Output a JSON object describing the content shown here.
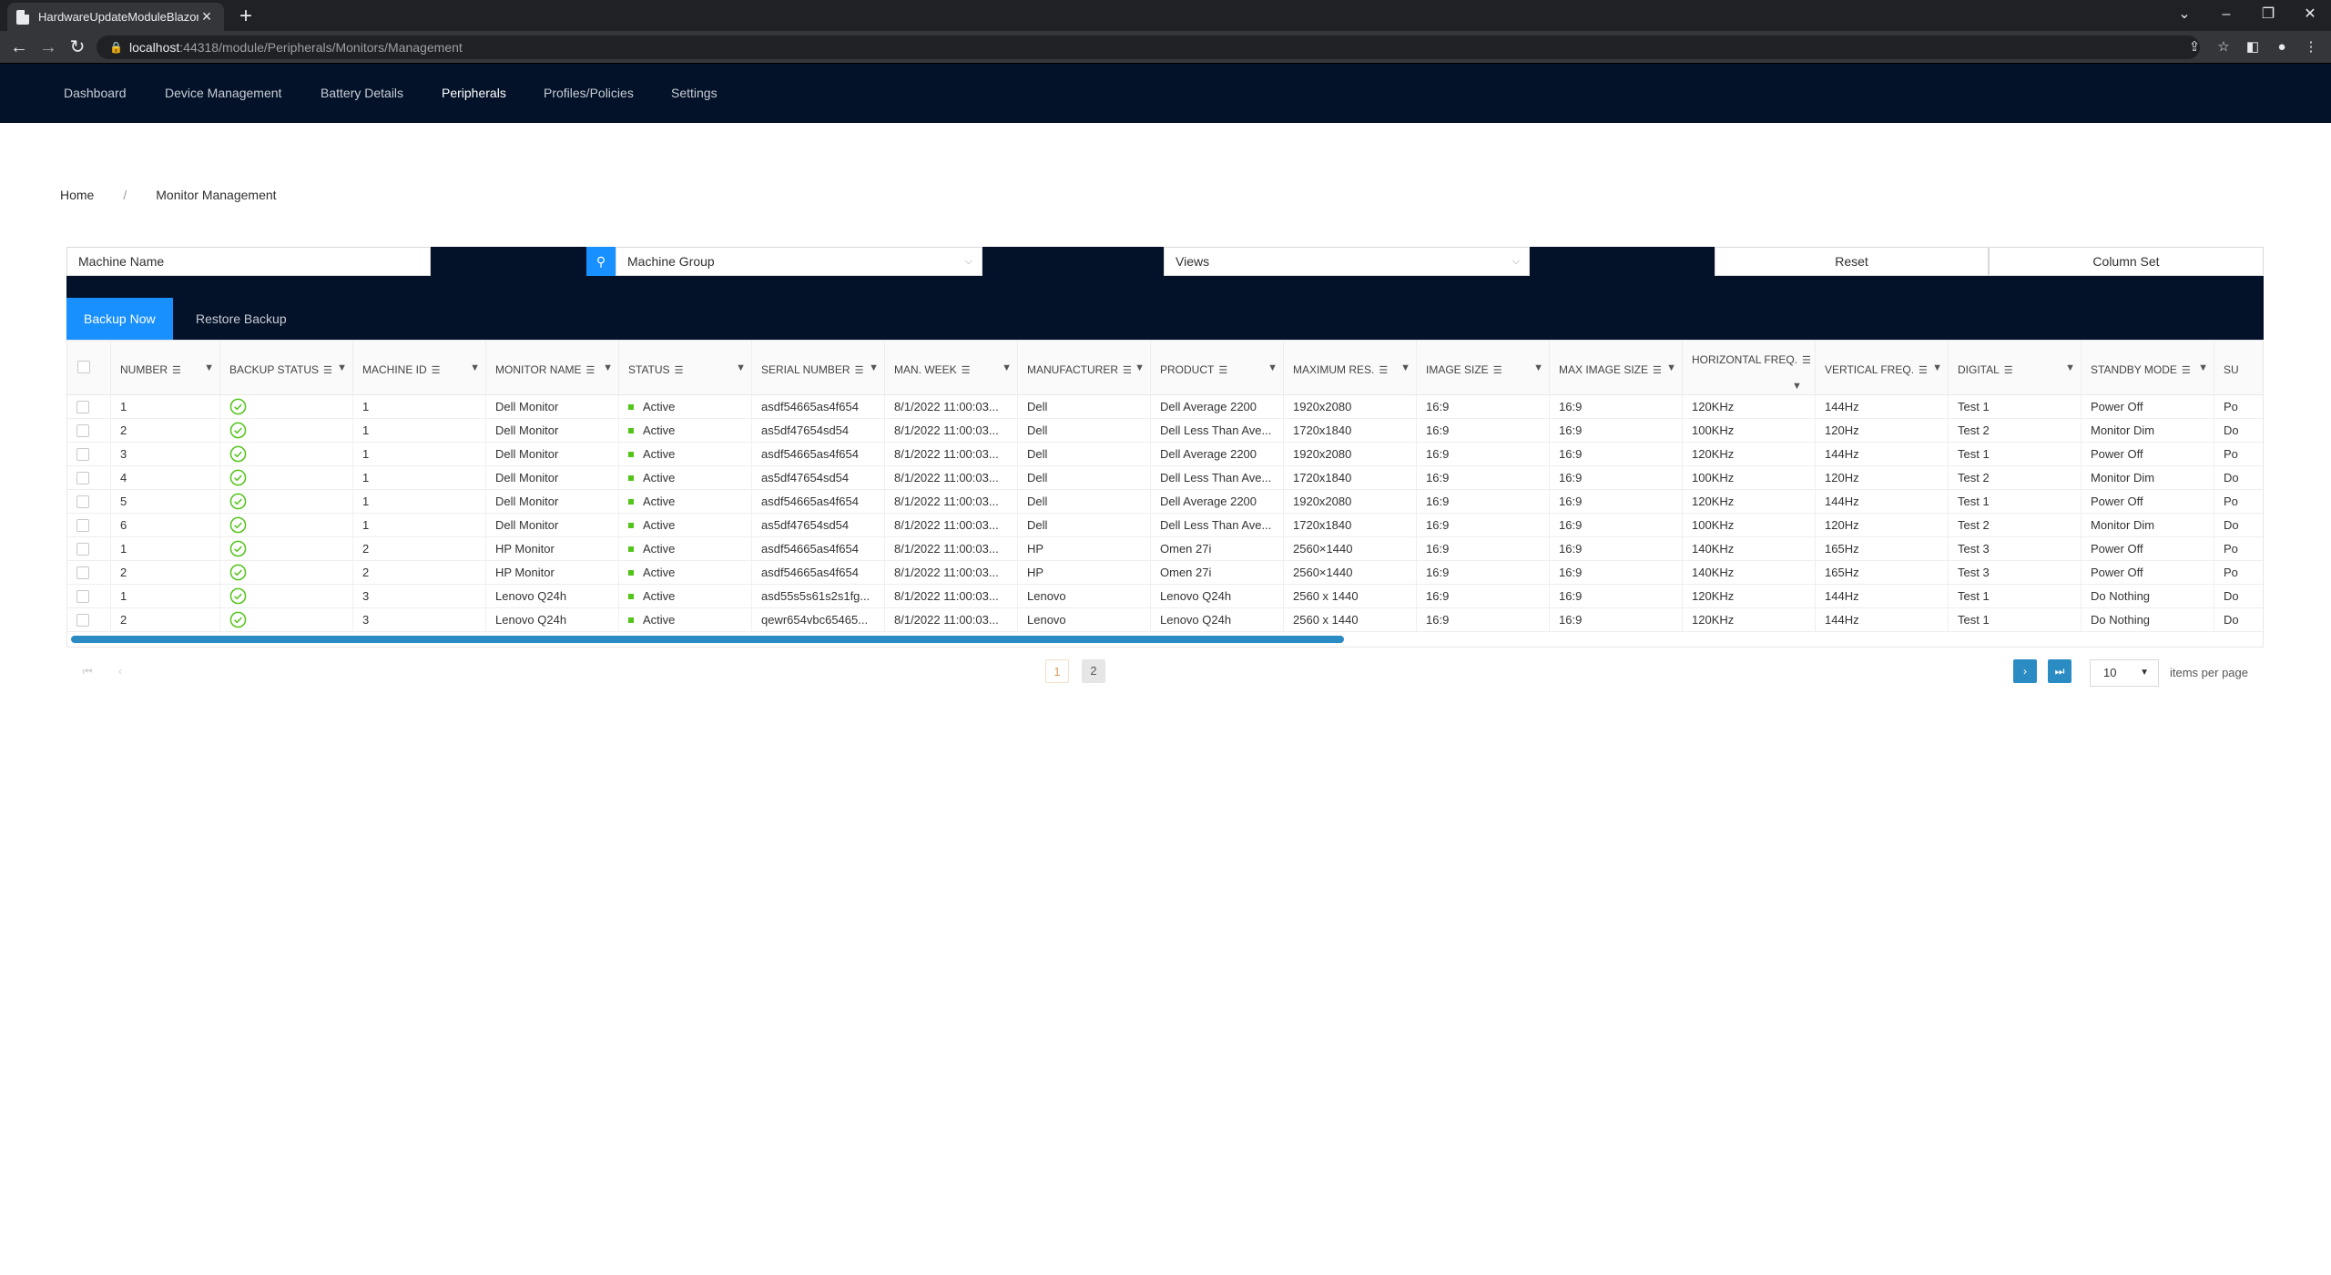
{
  "browser": {
    "tab_title": "HardwareUpdateModuleBlazor",
    "url_host": "localhost",
    "url_rest": ":44318/module/Peripherals/Monitors/Management"
  },
  "nav": {
    "items": [
      "Dashboard",
      "Device Management",
      "Battery Details",
      "Peripherals",
      "Profiles/Policies",
      "Settings"
    ],
    "active": "Peripherals"
  },
  "breadcrumb": {
    "home": "Home",
    "separator": "/",
    "current": "Monitor Management"
  },
  "filters": {
    "machine_name_placeholder": "Machine Name",
    "machine_group": "Machine Group",
    "views": "Views",
    "reset_label": "Reset",
    "column_set_label": "Column Set"
  },
  "toolbar": {
    "backup_now_label": "Backup Now",
    "restore_backup_label": "Restore Backup"
  },
  "grid": {
    "columns": [
      "Number",
      "Backup Status",
      "Machine ID",
      "Monitor Name",
      "Status",
      "Serial Number",
      "Man. Week",
      "Manufacturer",
      "Product",
      "Maximum Res.",
      "Image Size",
      "Max Image Size",
      "Horizontal Freq.",
      "Vertical Freq.",
      "Digital",
      "Standby Mode",
      "Su"
    ],
    "rows": [
      [
        "1",
        "ok",
        "1",
        "Dell Monitor",
        "Active",
        "asdf54665as4f654",
        "8/1/2022 11:00:03...",
        "Dell",
        "Dell Average 2200",
        "1920x2080",
        "16:9",
        "16:9",
        "120KHz",
        "144Hz",
        "Test 1",
        "Power Off",
        "Po"
      ],
      [
        "2",
        "ok",
        "1",
        "Dell Monitor",
        "Active",
        "as5df47654sd54",
        "8/1/2022 11:00:03...",
        "Dell",
        "Dell Less Than Ave...",
        "1720x1840",
        "16:9",
        "16:9",
        "100KHz",
        "120Hz",
        "Test 2",
        "Monitor Dim",
        "Do"
      ],
      [
        "3",
        "ok",
        "1",
        "Dell Monitor",
        "Active",
        "asdf54665as4f654",
        "8/1/2022 11:00:03...",
        "Dell",
        "Dell Average 2200",
        "1920x2080",
        "16:9",
        "16:9",
        "120KHz",
        "144Hz",
        "Test 1",
        "Power Off",
        "Po"
      ],
      [
        "4",
        "ok",
        "1",
        "Dell Monitor",
        "Active",
        "as5df47654sd54",
        "8/1/2022 11:00:03...",
        "Dell",
        "Dell Less Than Ave...",
        "1720x1840",
        "16:9",
        "16:9",
        "100KHz",
        "120Hz",
        "Test 2",
        "Monitor Dim",
        "Do"
      ],
      [
        "5",
        "ok",
        "1",
        "Dell Monitor",
        "Active",
        "asdf54665as4f654",
        "8/1/2022 11:00:03...",
        "Dell",
        "Dell Average 2200",
        "1920x2080",
        "16:9",
        "16:9",
        "120KHz",
        "144Hz",
        "Test 1",
        "Power Off",
        "Po"
      ],
      [
        "6",
        "ok",
        "1",
        "Dell Monitor",
        "Active",
        "as5df47654sd54",
        "8/1/2022 11:00:03...",
        "Dell",
        "Dell Less Than Ave...",
        "1720x1840",
        "16:9",
        "16:9",
        "100KHz",
        "120Hz",
        "Test 2",
        "Monitor Dim",
        "Do"
      ],
      [
        "1",
        "ok",
        "2",
        "HP Monitor",
        "Active",
        "asdf54665as4f654",
        "8/1/2022 11:00:03...",
        "HP",
        "Omen 27i",
        "2560×1440",
        "16:9",
        "16:9",
        "140KHz",
        "165Hz",
        "Test 3",
        "Power Off",
        "Po"
      ],
      [
        "2",
        "ok",
        "2",
        "HP Monitor",
        "Active",
        "asdf54665as4f654",
        "8/1/2022 11:00:03...",
        "HP",
        "Omen 27i",
        "2560×1440",
        "16:9",
        "16:9",
        "140KHz",
        "165Hz",
        "Test 3",
        "Power Off",
        "Po"
      ],
      [
        "1",
        "ok",
        "3",
        "Lenovo Q24h",
        "Active",
        "asd55s5s61s2s1fg...",
        "8/1/2022 11:00:03...",
        "Lenovo",
        "Lenovo Q24h",
        "2560 x 1440",
        "16:9",
        "16:9",
        "120KHz",
        "144Hz",
        "Test 1",
        "Do Nothing",
        "Do"
      ],
      [
        "2",
        "ok",
        "3",
        "Lenovo Q24h",
        "Active",
        "qewr654vbc65465...",
        "8/1/2022 11:00:03...",
        "Lenovo",
        "Lenovo Q24h",
        "2560 x 1440",
        "16:9",
        "16:9",
        "120KHz",
        "144Hz",
        "Test 1",
        "Do Nothing",
        "Do"
      ]
    ]
  },
  "pager": {
    "pages": [
      "1",
      "2"
    ],
    "current": "1",
    "page_size": "10",
    "page_size_label": "items per page"
  },
  "colors": {
    "nav_bg": "#031229",
    "primary": "#1890ff",
    "success": "#52c41a",
    "pager_blue": "#2b8cc4"
  }
}
